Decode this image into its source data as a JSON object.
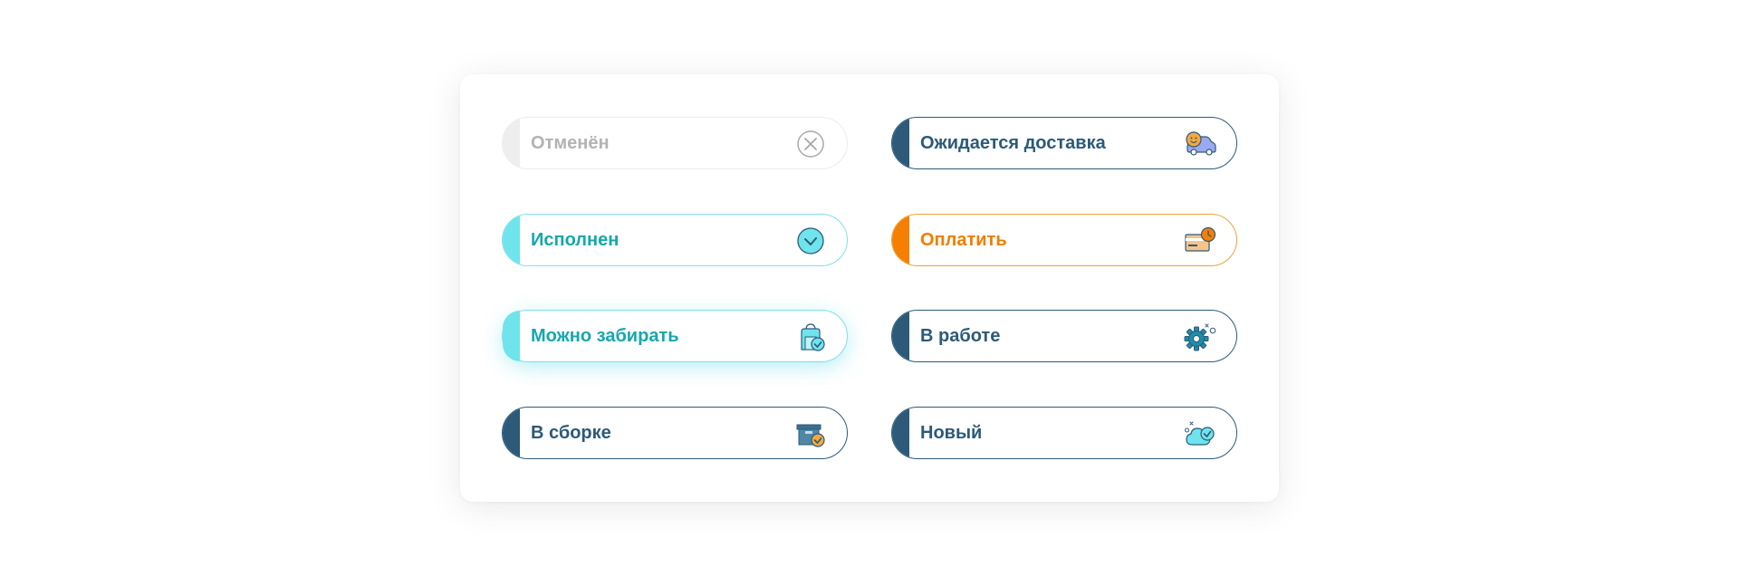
{
  "statuses": {
    "cancelled": {
      "label": "Отменён",
      "icon": "cancel-circle-icon"
    },
    "awaiting_delivery": {
      "label": "Ожидается доставка",
      "icon": "delivery-car-icon"
    },
    "done": {
      "label": "Исполнен",
      "icon": "check-circle-icon"
    },
    "pay": {
      "label": "Оплатить",
      "icon": "payment-card-clock-icon"
    },
    "ready_pickup": {
      "label": "Можно забирать",
      "icon": "bag-check-icon"
    },
    "in_progress": {
      "label": "В работе",
      "icon": "gear-icon"
    },
    "assembling": {
      "label": "В сборке",
      "icon": "box-check-icon"
    },
    "new": {
      "label": "Новый",
      "icon": "cloud-check-icon"
    }
  },
  "colors": {
    "dark": "#2d5a78",
    "cyan": "#6fe4ec",
    "cyan_text": "#16a7ad",
    "orange": "#f57f00",
    "grey": "#b3b3b3"
  }
}
